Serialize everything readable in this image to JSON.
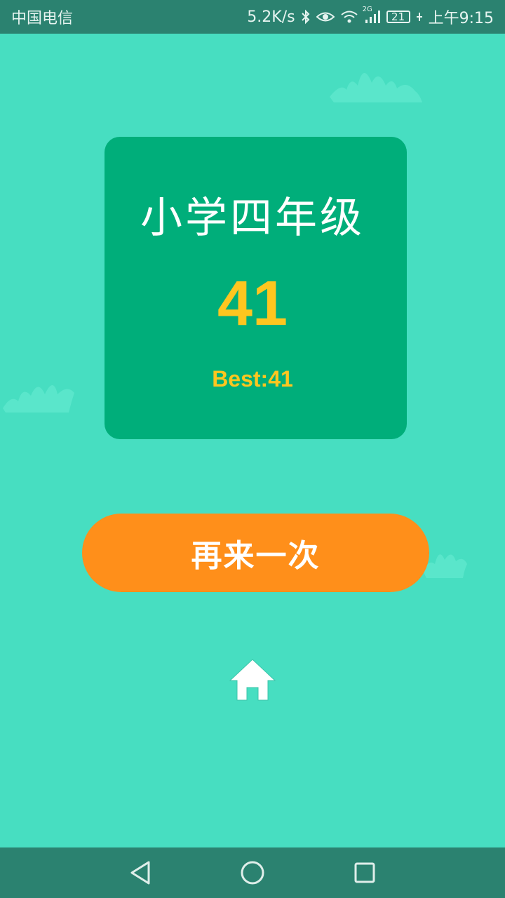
{
  "status_bar": {
    "carrier": "中国电信",
    "net_speed": "5.2K/s",
    "network_type": "2G",
    "battery_level": "21",
    "time": "上午9:15",
    "icons": [
      "bluetooth-icon",
      "eye-comfort-icon",
      "wifi-icon",
      "signal-icon",
      "battery-icon",
      "charging-icon"
    ]
  },
  "result_card": {
    "grade_title": "小学四年级",
    "score": "41",
    "best": "Best:41"
  },
  "actions": {
    "retry_label": "再来一次",
    "home_icon": "home-icon"
  },
  "nav_bar": {
    "icons": [
      "back-icon",
      "home-circle-icon",
      "recents-icon"
    ]
  },
  "colors": {
    "background": "#47dec1",
    "card": "#00ae7a",
    "score": "#fec61f",
    "button": "#ff8f1a",
    "bars": "#2b8270"
  }
}
